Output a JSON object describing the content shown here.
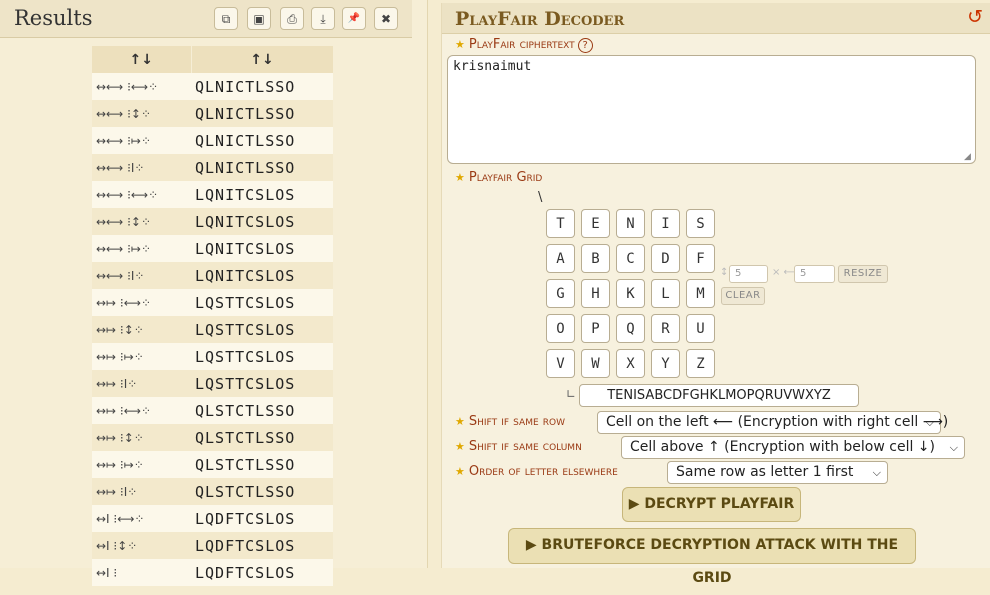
{
  "results": {
    "title": "Results",
    "toolbar": {
      "copy_icon": "copy-icon",
      "save_icon": "save-icon",
      "print_icon": "print-icon",
      "download_icon": "download-icon",
      "pin_icon": "pin-icon",
      "close_icon": "close-icon",
      "copy": "⧉",
      "save": "▣",
      "print": "⎙",
      "download": "⤓",
      "pin": "📌",
      "close": "✖"
    },
    "columns": [
      "↑↓",
      "↑↓"
    ],
    "rows": [
      {
        "shift": "↔⟷ ⁝⟷⁘",
        "text": "QLNICTLSSO"
      },
      {
        "shift": "↔⟷ ⁝↕⁘",
        "text": "QLNICTLSSO"
      },
      {
        "shift": "↔⟷ ⁝↦⁘",
        "text": "QLNICTLSSO"
      },
      {
        "shift": "↔⟷ ⁝I⁘",
        "text": "QLNICTLSSO"
      },
      {
        "shift": "↔⟷ ⁝⟷⁘",
        "text": "LQNITCSLOS"
      },
      {
        "shift": "↔⟷ ⁝↕⁘",
        "text": "LQNITCSLOS"
      },
      {
        "shift": "↔⟷ ⁝↦⁘",
        "text": "LQNITCSLOS"
      },
      {
        "shift": "↔⟷ ⁝I⁘",
        "text": "LQNITCSLOS"
      },
      {
        "shift": "↔↦ ⁝⟷⁘",
        "text": "LQSTTCSLOS"
      },
      {
        "shift": "↔↦ ⁝↕⁘",
        "text": "LQSTTCSLOS"
      },
      {
        "shift": "↔↦ ⁝↦⁘",
        "text": "LQSTTCSLOS"
      },
      {
        "shift": "↔↦ ⁝I⁘",
        "text": "LQSTTCSLOS"
      },
      {
        "shift": "↔↦ ⁝⟷⁘",
        "text": "QLSTCTLSSO"
      },
      {
        "shift": "↔↦ ⁝↕⁘",
        "text": "QLSTCTLSSO"
      },
      {
        "shift": "↔↦ ⁝↦⁘",
        "text": "QLSTCTLSSO"
      },
      {
        "shift": "↔↦ ⁝I⁘",
        "text": "QLSTCTLSSO"
      },
      {
        "shift": "↔I ⁝⟷⁘",
        "text": "LQDFTCSLOS"
      },
      {
        "shift": "↔I ⁝↕⁘",
        "text": "LQDFTCSLOS"
      },
      {
        "shift": "↔I ⁝",
        "text": "LQDFTCSLOS"
      }
    ]
  },
  "decoder": {
    "title": "PlayFair Decoder",
    "reset_icon": "undo-icon",
    "reset_glyph": "↺",
    "ciphertext_label": "PlayFair ciphertext",
    "help_glyph": "?",
    "ciphertext_value": "krisnaimut",
    "grid_label": "Playfair Grid",
    "grid_corner": "\\",
    "grid": [
      [
        "T",
        "E",
        "N",
        "I",
        "S"
      ],
      [
        "A",
        "B",
        "C",
        "D",
        "F"
      ],
      [
        "G",
        "H",
        "K",
        "L",
        "M"
      ],
      [
        "O",
        "P",
        "Q",
        "R",
        "U"
      ],
      [
        "V",
        "W",
        "X",
        "Y",
        "Z"
      ]
    ],
    "rows_value": "5",
    "cols_value": "5",
    "resize_label": "RESIZE",
    "clear_label": "CLEAR",
    "key_value": "TENISABCDFGHKLMOPQRUVWXYZ",
    "same_row_label": "Shift if same row",
    "same_row_value": "Cell on the left ⟵ (Encryption with right cell ⟶)",
    "same_col_label": "Shift if same column",
    "same_col_value": "Cell above ↑ (Encryption with below cell ↓)",
    "order_label": "Order of letter elsewhere",
    "order_value": "Same row as letter 1 first",
    "decrypt_button": "▶ DECRYPT PLAYFAIR",
    "bruteforce_button": "▶ BRUTEFORCE DECRYPTION ATTACK WITH THE GRID",
    "colors": {
      "accent": "#7a5a20",
      "label": "#9a3a14",
      "star": "#e0a800",
      "reset": "#cc3300"
    }
  }
}
